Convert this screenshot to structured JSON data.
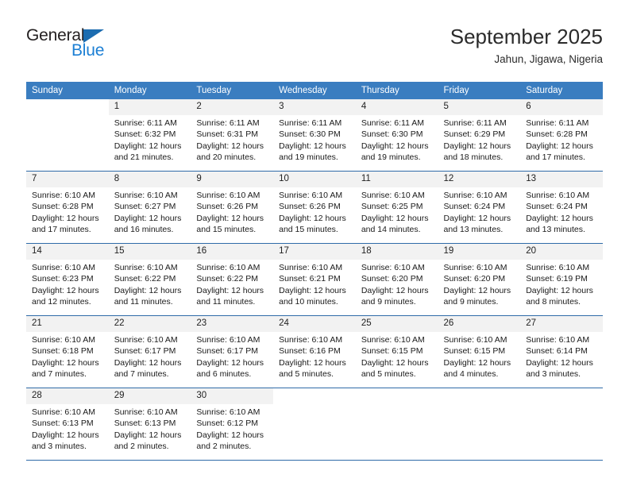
{
  "brand": {
    "name_top": "General",
    "name_bottom": "Blue",
    "accent_color": "#1c7fd4",
    "triangle_color": "#1c6cb0"
  },
  "header": {
    "title": "September 2025",
    "subtitle": "Jahun, Jigawa, Nigeria"
  },
  "calendar": {
    "header_background": "#3a7dc0",
    "row_separator_color": "#2f6ba8",
    "daynum_background": "#f2f2f2",
    "weekday_headers": [
      "Sunday",
      "Monday",
      "Tuesday",
      "Wednesday",
      "Thursday",
      "Friday",
      "Saturday"
    ],
    "weeks": [
      [
        {
          "day": "",
          "sunrise": "",
          "sunset": "",
          "daylight_line1": "",
          "daylight_line2": ""
        },
        {
          "day": "1",
          "sunrise": "Sunrise: 6:11 AM",
          "sunset": "Sunset: 6:32 PM",
          "daylight_line1": "Daylight: 12 hours",
          "daylight_line2": "and 21 minutes."
        },
        {
          "day": "2",
          "sunrise": "Sunrise: 6:11 AM",
          "sunset": "Sunset: 6:31 PM",
          "daylight_line1": "Daylight: 12 hours",
          "daylight_line2": "and 20 minutes."
        },
        {
          "day": "3",
          "sunrise": "Sunrise: 6:11 AM",
          "sunset": "Sunset: 6:30 PM",
          "daylight_line1": "Daylight: 12 hours",
          "daylight_line2": "and 19 minutes."
        },
        {
          "day": "4",
          "sunrise": "Sunrise: 6:11 AM",
          "sunset": "Sunset: 6:30 PM",
          "daylight_line1": "Daylight: 12 hours",
          "daylight_line2": "and 19 minutes."
        },
        {
          "day": "5",
          "sunrise": "Sunrise: 6:11 AM",
          "sunset": "Sunset: 6:29 PM",
          "daylight_line1": "Daylight: 12 hours",
          "daylight_line2": "and 18 minutes."
        },
        {
          "day": "6",
          "sunrise": "Sunrise: 6:11 AM",
          "sunset": "Sunset: 6:28 PM",
          "daylight_line1": "Daylight: 12 hours",
          "daylight_line2": "and 17 minutes."
        }
      ],
      [
        {
          "day": "7",
          "sunrise": "Sunrise: 6:10 AM",
          "sunset": "Sunset: 6:28 PM",
          "daylight_line1": "Daylight: 12 hours",
          "daylight_line2": "and 17 minutes."
        },
        {
          "day": "8",
          "sunrise": "Sunrise: 6:10 AM",
          "sunset": "Sunset: 6:27 PM",
          "daylight_line1": "Daylight: 12 hours",
          "daylight_line2": "and 16 minutes."
        },
        {
          "day": "9",
          "sunrise": "Sunrise: 6:10 AM",
          "sunset": "Sunset: 6:26 PM",
          "daylight_line1": "Daylight: 12 hours",
          "daylight_line2": "and 15 minutes."
        },
        {
          "day": "10",
          "sunrise": "Sunrise: 6:10 AM",
          "sunset": "Sunset: 6:26 PM",
          "daylight_line1": "Daylight: 12 hours",
          "daylight_line2": "and 15 minutes."
        },
        {
          "day": "11",
          "sunrise": "Sunrise: 6:10 AM",
          "sunset": "Sunset: 6:25 PM",
          "daylight_line1": "Daylight: 12 hours",
          "daylight_line2": "and 14 minutes."
        },
        {
          "day": "12",
          "sunrise": "Sunrise: 6:10 AM",
          "sunset": "Sunset: 6:24 PM",
          "daylight_line1": "Daylight: 12 hours",
          "daylight_line2": "and 13 minutes."
        },
        {
          "day": "13",
          "sunrise": "Sunrise: 6:10 AM",
          "sunset": "Sunset: 6:24 PM",
          "daylight_line1": "Daylight: 12 hours",
          "daylight_line2": "and 13 minutes."
        }
      ],
      [
        {
          "day": "14",
          "sunrise": "Sunrise: 6:10 AM",
          "sunset": "Sunset: 6:23 PM",
          "daylight_line1": "Daylight: 12 hours",
          "daylight_line2": "and 12 minutes."
        },
        {
          "day": "15",
          "sunrise": "Sunrise: 6:10 AM",
          "sunset": "Sunset: 6:22 PM",
          "daylight_line1": "Daylight: 12 hours",
          "daylight_line2": "and 11 minutes."
        },
        {
          "day": "16",
          "sunrise": "Sunrise: 6:10 AM",
          "sunset": "Sunset: 6:22 PM",
          "daylight_line1": "Daylight: 12 hours",
          "daylight_line2": "and 11 minutes."
        },
        {
          "day": "17",
          "sunrise": "Sunrise: 6:10 AM",
          "sunset": "Sunset: 6:21 PM",
          "daylight_line1": "Daylight: 12 hours",
          "daylight_line2": "and 10 minutes."
        },
        {
          "day": "18",
          "sunrise": "Sunrise: 6:10 AM",
          "sunset": "Sunset: 6:20 PM",
          "daylight_line1": "Daylight: 12 hours",
          "daylight_line2": "and 9 minutes."
        },
        {
          "day": "19",
          "sunrise": "Sunrise: 6:10 AM",
          "sunset": "Sunset: 6:20 PM",
          "daylight_line1": "Daylight: 12 hours",
          "daylight_line2": "and 9 minutes."
        },
        {
          "day": "20",
          "sunrise": "Sunrise: 6:10 AM",
          "sunset": "Sunset: 6:19 PM",
          "daylight_line1": "Daylight: 12 hours",
          "daylight_line2": "and 8 minutes."
        }
      ],
      [
        {
          "day": "21",
          "sunrise": "Sunrise: 6:10 AM",
          "sunset": "Sunset: 6:18 PM",
          "daylight_line1": "Daylight: 12 hours",
          "daylight_line2": "and 7 minutes."
        },
        {
          "day": "22",
          "sunrise": "Sunrise: 6:10 AM",
          "sunset": "Sunset: 6:17 PM",
          "daylight_line1": "Daylight: 12 hours",
          "daylight_line2": "and 7 minutes."
        },
        {
          "day": "23",
          "sunrise": "Sunrise: 6:10 AM",
          "sunset": "Sunset: 6:17 PM",
          "daylight_line1": "Daylight: 12 hours",
          "daylight_line2": "and 6 minutes."
        },
        {
          "day": "24",
          "sunrise": "Sunrise: 6:10 AM",
          "sunset": "Sunset: 6:16 PM",
          "daylight_line1": "Daylight: 12 hours",
          "daylight_line2": "and 5 minutes."
        },
        {
          "day": "25",
          "sunrise": "Sunrise: 6:10 AM",
          "sunset": "Sunset: 6:15 PM",
          "daylight_line1": "Daylight: 12 hours",
          "daylight_line2": "and 5 minutes."
        },
        {
          "day": "26",
          "sunrise": "Sunrise: 6:10 AM",
          "sunset": "Sunset: 6:15 PM",
          "daylight_line1": "Daylight: 12 hours",
          "daylight_line2": "and 4 minutes."
        },
        {
          "day": "27",
          "sunrise": "Sunrise: 6:10 AM",
          "sunset": "Sunset: 6:14 PM",
          "daylight_line1": "Daylight: 12 hours",
          "daylight_line2": "and 3 minutes."
        }
      ],
      [
        {
          "day": "28",
          "sunrise": "Sunrise: 6:10 AM",
          "sunset": "Sunset: 6:13 PM",
          "daylight_line1": "Daylight: 12 hours",
          "daylight_line2": "and 3 minutes."
        },
        {
          "day": "29",
          "sunrise": "Sunrise: 6:10 AM",
          "sunset": "Sunset: 6:13 PM",
          "daylight_line1": "Daylight: 12 hours",
          "daylight_line2": "and 2 minutes."
        },
        {
          "day": "30",
          "sunrise": "Sunrise: 6:10 AM",
          "sunset": "Sunset: 6:12 PM",
          "daylight_line1": "Daylight: 12 hours",
          "daylight_line2": "and 2 minutes."
        },
        {
          "day": "",
          "sunrise": "",
          "sunset": "",
          "daylight_line1": "",
          "daylight_line2": ""
        },
        {
          "day": "",
          "sunrise": "",
          "sunset": "",
          "daylight_line1": "",
          "daylight_line2": ""
        },
        {
          "day": "",
          "sunrise": "",
          "sunset": "",
          "daylight_line1": "",
          "daylight_line2": ""
        },
        {
          "day": "",
          "sunrise": "",
          "sunset": "",
          "daylight_line1": "",
          "daylight_line2": ""
        }
      ]
    ]
  }
}
